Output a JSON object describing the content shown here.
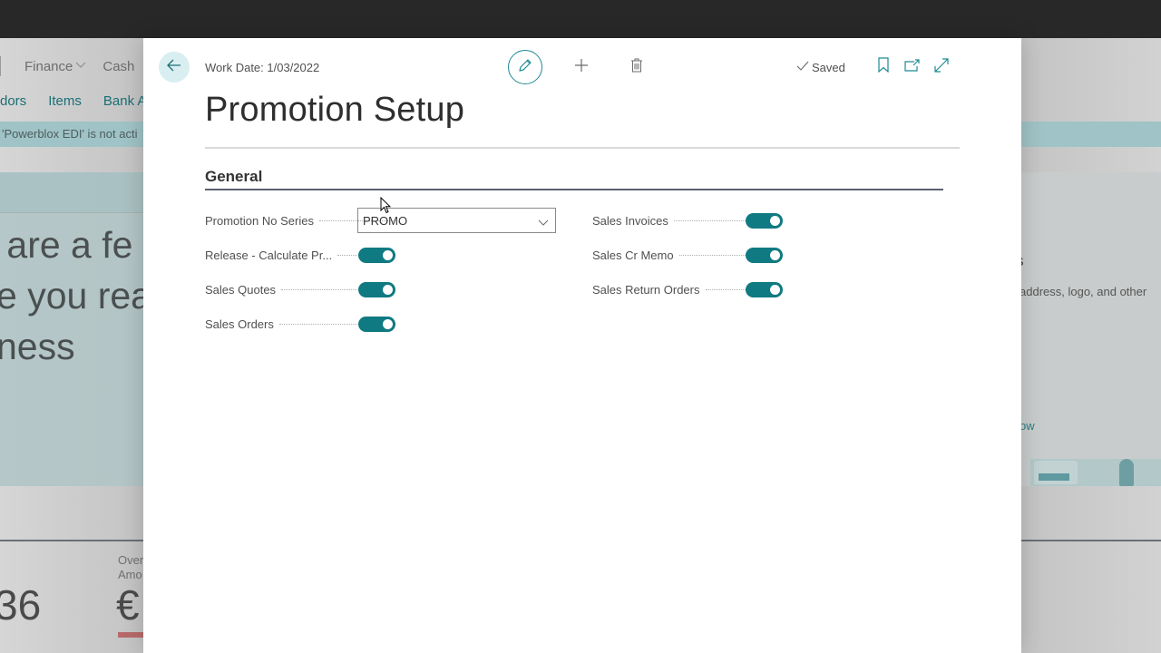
{
  "background": {
    "nav": [
      {
        "label": "Finance",
        "has_dropdown": true
      },
      {
        "label": "Cash",
        "has_dropdown": false
      }
    ],
    "links": [
      "dors",
      "Items",
      "Bank A"
    ],
    "banner_text": "'Powerblox EDI' is not acti",
    "hero_text": " are a fe\ne you rea\nness",
    "right_card": {
      "heading": "s",
      "description": "address, logo, and other",
      "link": "ow"
    },
    "kpis": {
      "value_partial": "36",
      "label": "Over\nAmo",
      "currency_partial": "€"
    }
  },
  "dialog": {
    "work_date": "Work Date: 1/03/2022",
    "title": "Promotion Setup",
    "status": "Saved",
    "toolbar": {
      "back": "back-arrow-icon",
      "edit": "pencil-icon",
      "new": "plus-icon",
      "delete": "trash-icon",
      "bookmark": "bookmark-icon",
      "open_new_window": "open-in-new-window-icon",
      "expand": "expand-icon"
    },
    "section": {
      "title": "General",
      "left_fields": [
        {
          "label": "Promotion No Series",
          "type": "select",
          "value": "PROMO"
        },
        {
          "label": "Release - Calculate Pr...",
          "type": "toggle",
          "value": true
        },
        {
          "label": "Sales Quotes",
          "type": "toggle",
          "value": true
        },
        {
          "label": "Sales Orders",
          "type": "toggle",
          "value": true
        }
      ],
      "right_fields": [
        {
          "label": "Sales Invoices",
          "type": "toggle",
          "value": true
        },
        {
          "label": "Sales Cr Memo",
          "type": "toggle",
          "value": true
        },
        {
          "label": "Sales Return Orders",
          "type": "toggle",
          "value": true
        }
      ]
    }
  },
  "colors": {
    "accent": "#0f7a82",
    "accent_light": "#d9eef0",
    "topbar": "#282828"
  }
}
